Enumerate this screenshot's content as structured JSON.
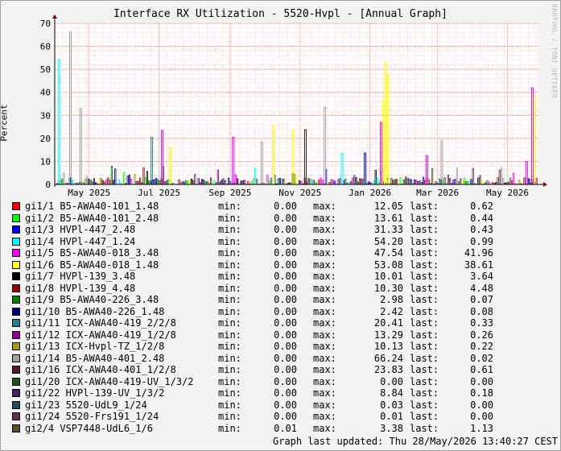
{
  "graph": {
    "title": "Interface RX Utilization - 5520-Hvpl - [Annual Graph]",
    "watermark": "RRDTOOL / TOBI OETIKER",
    "footer": "Graph last updated: Thu 28/May/2026 13:40:27 CEST",
    "labels": {
      "min": "min:",
      "max": "max:",
      "last": "last:"
    }
  },
  "chart_data": {
    "type": "bar",
    "title": "Interface RX Utilization - 5520-Hvpl - [Annual Graph]",
    "xlabel": "",
    "ylabel": "Percent",
    "ylim": [
      0,
      70
    ],
    "yticks": [
      0,
      10,
      20,
      30,
      40,
      50,
      60,
      70
    ],
    "xlim": [
      "2025-04-01",
      "2026-05-28"
    ],
    "xticks": [
      {
        "date": "2025-05-01",
        "label": "May 2025"
      },
      {
        "date": "2025-07-01",
        "label": "Jul 2025"
      },
      {
        "date": "2025-09-01",
        "label": "Sep 2025"
      },
      {
        "date": "2025-11-01",
        "label": "Nov 2025"
      },
      {
        "date": "2026-01-01",
        "label": "Jan 2026"
      },
      {
        "date": "2026-03-01",
        "label": "Mar 2026"
      },
      {
        "date": "2026-05-01",
        "label": "May 2026"
      }
    ],
    "grid": true,
    "spikes": [
      {
        "date": "2025-04-04",
        "value": 54.2,
        "color": "#00ffff"
      },
      {
        "date": "2025-04-14",
        "value": 66.2,
        "color": "#a0a0a0"
      },
      {
        "date": "2025-04-23",
        "value": 33.0,
        "color": "#a0a0a0"
      },
      {
        "date": "2025-06-24",
        "value": 20.4,
        "color": "#208080"
      },
      {
        "date": "2025-07-03",
        "value": 23.5,
        "color": "#ff00ff"
      },
      {
        "date": "2025-07-10",
        "value": 16.0,
        "color": "#ffff00"
      },
      {
        "date": "2025-09-03",
        "value": 20.5,
        "color": "#ff00ff"
      },
      {
        "date": "2025-09-28",
        "value": 18.5,
        "color": "#a0a0a0"
      },
      {
        "date": "2025-10-08",
        "value": 25.5,
        "color": "#ffff00"
      },
      {
        "date": "2025-10-25",
        "value": 23.5,
        "color": "#ffff00"
      },
      {
        "date": "2025-11-05",
        "value": 23.8,
        "color": "#502020"
      },
      {
        "date": "2025-11-22",
        "value": 33.5,
        "color": "#a0a0a0"
      },
      {
        "date": "2025-12-07",
        "value": 13.5,
        "color": "#00ffff"
      },
      {
        "date": "2025-12-27",
        "value": 13.6,
        "color": "#0000ff"
      },
      {
        "date": "2026-01-10",
        "value": 27.0,
        "color": "#ff00ff"
      },
      {
        "date": "2026-01-12",
        "value": 36.5,
        "color": "#ffff00"
      },
      {
        "date": "2026-01-14",
        "value": 53.1,
        "color": "#ffff00"
      },
      {
        "date": "2026-01-16",
        "value": 47.5,
        "color": "#ffff00"
      },
      {
        "date": "2026-02-19",
        "value": 12.5,
        "color": "#ff00ff"
      },
      {
        "date": "2026-03-04",
        "value": 19.0,
        "color": "#a0a0a0"
      },
      {
        "date": "2026-05-22",
        "value": 41.96,
        "color": "#ff00ff"
      },
      {
        "date": "2026-05-24",
        "value": 38.6,
        "color": "#ffff00"
      },
      {
        "date": "2026-05-17",
        "value": 10.0,
        "color": "#ff00ff"
      }
    ],
    "series": [
      {
        "name": "gi1/1 B5-AWA40-101_1.48",
        "color": "#ff0000",
        "min": "0.00",
        "max": "12.05",
        "last": "0.62"
      },
      {
        "name": "gi1/2 B5-AWA40-101_2.48",
        "color": "#00ff00",
        "min": "0.00",
        "max": "13.61",
        "last": "0.44"
      },
      {
        "name": "gi1/3 HVPl-447_2.48",
        "color": "#0000ff",
        "min": "0.00",
        "max": "31.33",
        "last": "0.43"
      },
      {
        "name": "gi1/4 HVPl-447_1.24",
        "color": "#00ffff",
        "min": "0.00",
        "max": "54.20",
        "last": "0.99"
      },
      {
        "name": "gi1/5 B5-AWA40-018_3.48",
        "color": "#ff00ff",
        "min": "0.00",
        "max": "47.54",
        "last": "41.96"
      },
      {
        "name": "gi1/6 B5-AWA40-018_1.48",
        "color": "#ffff00",
        "min": "0.00",
        "max": "53.08",
        "last": "38.61"
      },
      {
        "name": "gi1/7 HVPl-139_3.48",
        "color": "#000000",
        "min": "0.00",
        "max": "10.01",
        "last": "3.64"
      },
      {
        "name": "gi1/8 HVPl-139_4.48",
        "color": "#a00000",
        "min": "0.00",
        "max": "10.30",
        "last": "4.48"
      },
      {
        "name": "gi1/9 B5-AWA40-226_3.48",
        "color": "#008000",
        "min": "0.00",
        "max": "2.98",
        "last": "0.07"
      },
      {
        "name": "gi1/10 B5-AWA40-226_1.48",
        "color": "#000080",
        "min": "0.00",
        "max": "2.42",
        "last": "0.08"
      },
      {
        "name": "gi1/11 ICX-AWA40-419_2/2/8",
        "color": "#208090",
        "min": "0.00",
        "max": "20.41",
        "last": "0.33"
      },
      {
        "name": "gi1/12 ICX-AWA40-419_1/2/8",
        "color": "#900090",
        "min": "0.00",
        "max": "13.29",
        "last": "0.26"
      },
      {
        "name": "gi1/13 ICX-Hvpl-TZ_1/2/8",
        "color": "#a0a000",
        "min": "0.00",
        "max": "10.13",
        "last": "0.22"
      },
      {
        "name": "gi1/14 B5-AWA40-401_2.48",
        "color": "#a0a0a0",
        "min": "0.00",
        "max": "66.24",
        "last": "0.02"
      },
      {
        "name": "gi1/16 ICX-AWA40-401_1/2/8",
        "color": "#502020",
        "min": "0.00",
        "max": "23.83",
        "last": "0.61"
      },
      {
        "name": "gi1/20 ICX-AWA40-419-UV_1/3/2",
        "color": "#205020",
        "min": "0.00",
        "max": "0.00",
        "last": "0.00"
      },
      {
        "name": "gi1/22 HVPl-139-UV_1/3/2",
        "color": "#402060",
        "min": "0.00",
        "max": "8.84",
        "last": "0.18"
      },
      {
        "name": "gi1/23 5520-UdL9_1/24",
        "color": "#205060",
        "min": "0.00",
        "max": "0.03",
        "last": "0.00"
      },
      {
        "name": "gi1/24 5520-Frs191_1/24",
        "color": "#603050",
        "min": "0.00",
        "max": "0.01",
        "last": "0.00"
      },
      {
        "name": "gi2/4 VSP7448-UdL6_1/6",
        "color": "#605020",
        "min": "0.01",
        "max": "3.38",
        "last": "1.13"
      }
    ]
  }
}
